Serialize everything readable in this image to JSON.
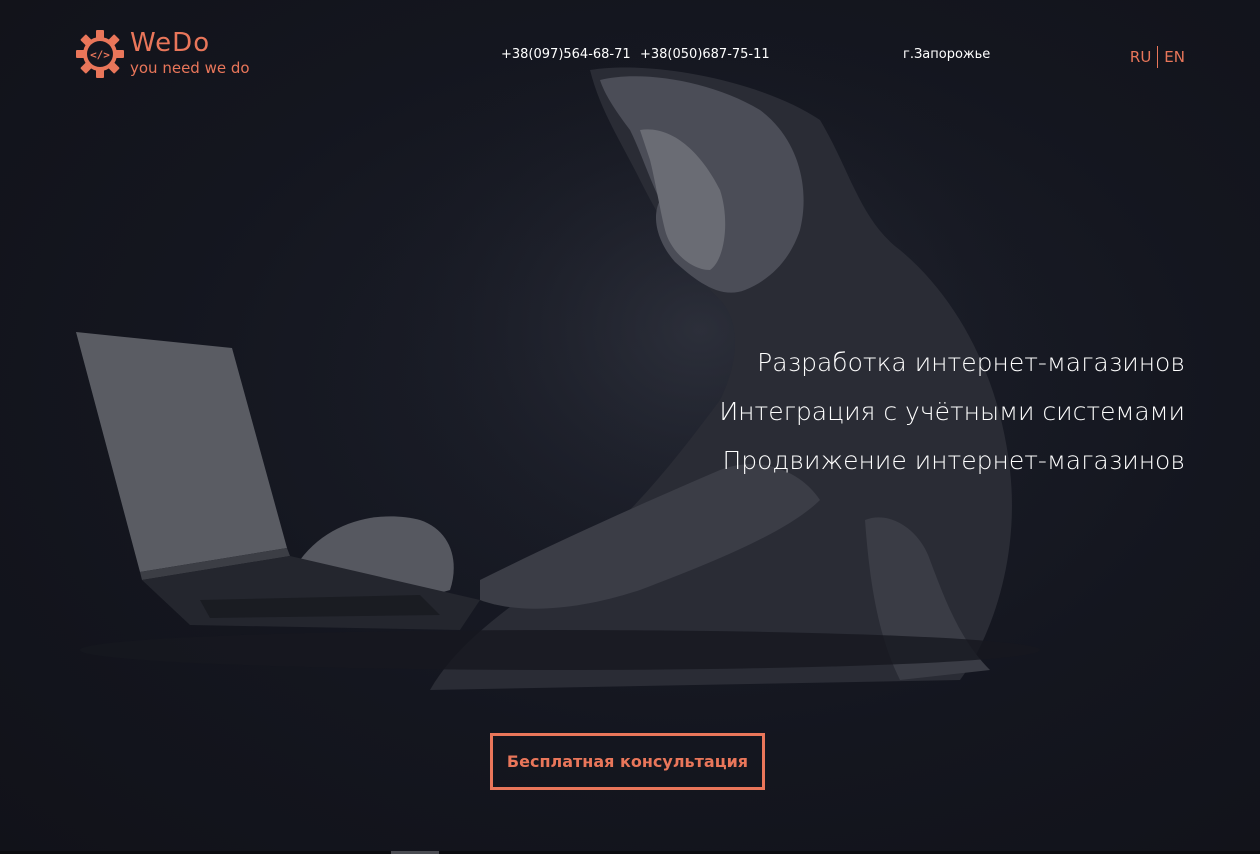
{
  "header": {
    "logo_name": "WeDo",
    "logo_tagline": "you need we do",
    "phone_1": "+38(097)564-68-71",
    "phone_2": "+38(050)687-75-11",
    "city": "г.Запорожье",
    "lang_ru": "RU",
    "lang_en": "EN"
  },
  "hero": {
    "lines": [
      "Разработка интернет-магазинов",
      "Интеграция с учётными системами",
      "Продвижение интернет-магазинов"
    ],
    "cta_label": "Бесплатная консультация"
  },
  "colors": {
    "accent": "#e9765a",
    "background": "#14161f",
    "text": "#ffffff"
  },
  "icons": {
    "logo": "gear-code-icon"
  }
}
